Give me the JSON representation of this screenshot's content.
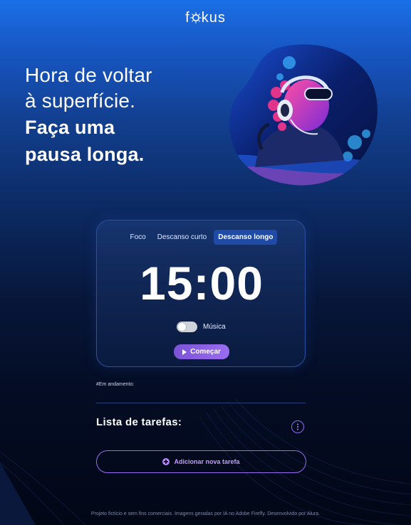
{
  "header": {
    "logo_pre": "f",
    "logo_post": "kus"
  },
  "hero": {
    "line1": "Hora de voltar",
    "line2": "à superfície.",
    "strong1": "Faça uma",
    "strong2": "pausa longa."
  },
  "timer_card": {
    "tabs": [
      {
        "label": "Foco",
        "active": false
      },
      {
        "label": "Descanso curto",
        "active": false
      },
      {
        "label": "Descanso longo",
        "active": true
      }
    ],
    "time": "15:00",
    "music_label": "Música",
    "music_on": false,
    "start_label": "Começar"
  },
  "in_progress_label": "#Em andamento:",
  "tasks": {
    "title": "Lista de tarefas:",
    "add_label": "Adicionar nova tarefa"
  },
  "footer": {
    "text": "Projeto fictício e sem fins comerciais. Imagens geradas por IA no Adobe Firefly. Desenvolvido por Alura."
  },
  "colors": {
    "accent": "#9a6cf0",
    "active_tab": "#1f4aa5"
  }
}
